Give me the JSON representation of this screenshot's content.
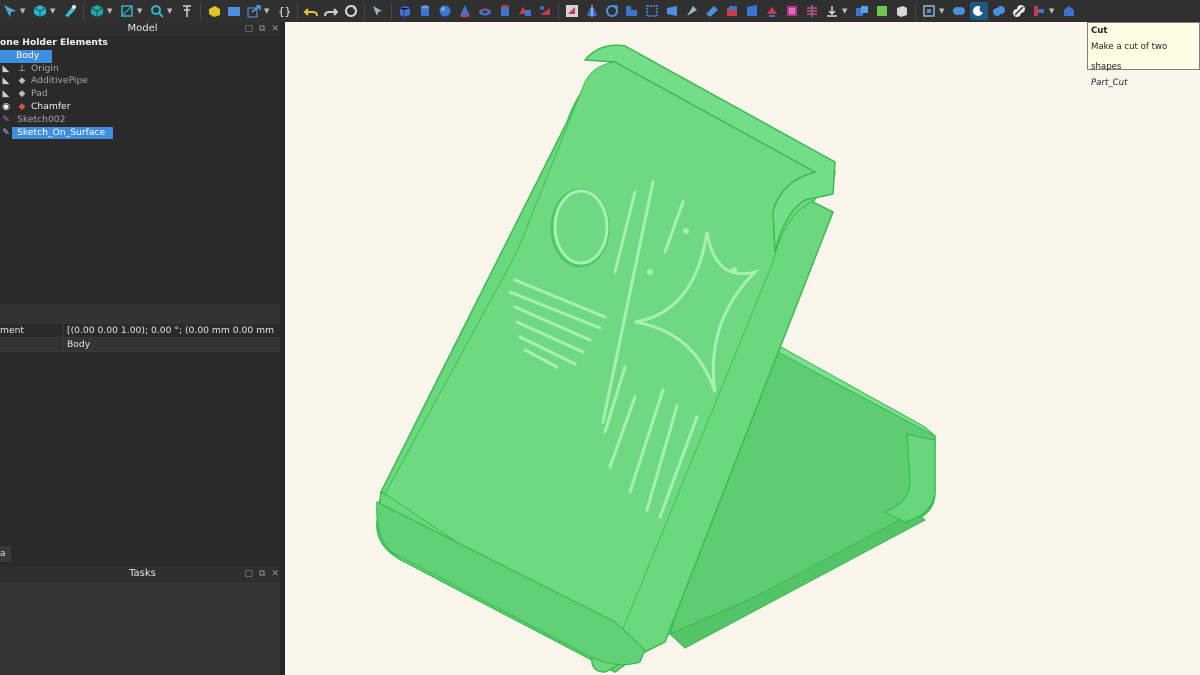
{
  "colors": {
    "viewport_bg": "#fbf6ec",
    "model_fill": "#6bd77f",
    "model_edge": "#39bb4f",
    "selection": "#3f8ee0",
    "tooltip_bg": "#fffde3"
  },
  "toolbar": {
    "icons": [
      "fit-all-icon",
      "view-cube-icon",
      "draw-style-icon",
      "isometric-view-icon",
      "std-views-icon",
      "zoom-icon",
      "measure-icon",
      "part-design-icon",
      "open-file-icon",
      "export-icon",
      "macro-braces-icon",
      "undo-icon",
      "redo-icon",
      "refresh-icon",
      "whats-this-icon",
      "box-icon",
      "cylinder-icon",
      "sphere-icon",
      "cone-icon",
      "torus-icon",
      "tube-icon",
      "primitives-icon",
      "shape-builder-icon",
      "extrude-icon",
      "revolve-icon",
      "mirror-icon",
      "fillet-icon",
      "chamfer-icon",
      "make-face-icon",
      "ruled-surface-icon",
      "loft-icon",
      "sweep-icon",
      "section-icon",
      "cross-sections-icon",
      "offset-icon",
      "thickness-icon",
      "projection-icon",
      "boolean-icon",
      "cut-icon",
      "fuse-icon",
      "common-icon",
      "split-icon",
      "compound-icon"
    ]
  },
  "model_panel": {
    "title": "Model",
    "tree": [
      {
        "label": "one Holder Elements",
        "icon": "document-icon",
        "style": "bold"
      },
      {
        "label": "Body",
        "icon": "body-icon",
        "style": "selected"
      },
      {
        "label": "Origin",
        "icon": "origin-icon",
        "style": "dim"
      },
      {
        "label": "AdditivePipe",
        "icon": "additive-pipe-icon",
        "style": "dim"
      },
      {
        "label": "Pad",
        "icon": "pad-icon",
        "style": "dim"
      },
      {
        "label": "Chamfer",
        "icon": "chamfer-icon",
        "style": "normal"
      },
      {
        "label": "Sketch002",
        "icon": "sketch-icon",
        "style": "dim"
      },
      {
        "label": "Sketch_On_Surface",
        "icon": "sketch-on-surface-icon",
        "style": "selected"
      }
    ]
  },
  "properties": {
    "rows": [
      {
        "key": "ment",
        "value": "[(0.00 0.00 1.00); 0.00 °; (0.00 mm  0.00 mm  ..."
      },
      {
        "key": "",
        "value": "Body"
      }
    ]
  },
  "combo_tab": {
    "label": "a"
  },
  "tasks_panel": {
    "title": "Tasks"
  },
  "tooltip": {
    "title": "Cut",
    "description": "Make a cut of two shapes",
    "command": "Part_Cut"
  }
}
